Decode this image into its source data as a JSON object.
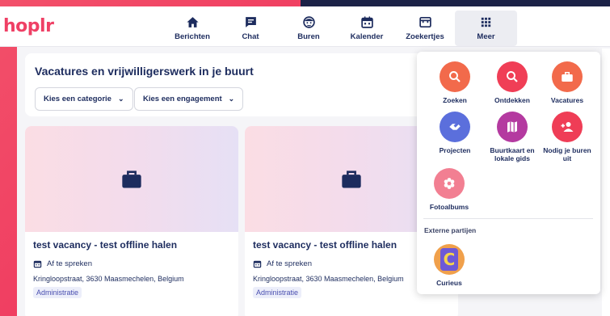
{
  "app": {
    "logo": "hoplr"
  },
  "nav": [
    {
      "label": "Berichten",
      "icon": "home-icon"
    },
    {
      "label": "Chat",
      "icon": "chat-icon"
    },
    {
      "label": "Buren",
      "icon": "neighbor-face-icon"
    },
    {
      "label": "Kalender",
      "icon": "calendar-icon"
    },
    {
      "label": "Zoekertjes",
      "icon": "shop-icon"
    },
    {
      "label": "Meer",
      "icon": "grid-icon",
      "active": true
    }
  ],
  "panel": {
    "title": "Vacatures en vrijwilligerswerk in je buurt",
    "filter_category": "Kies een categorie",
    "filter_engagement": "Kies een engagement"
  },
  "cards": [
    {
      "title": "test vacancy - test offline halen",
      "date": "Af te spreken",
      "address": "Kringloopstraat, 3630 Maasmechelen, Belgium",
      "tag": "Administratie"
    },
    {
      "title": "test vacancy - test offline halen",
      "date": "Af te spreken",
      "address": "Kringloopstraat, 3630 Maasmechelen, Belgium",
      "tag": "Administratie"
    }
  ],
  "menu": {
    "items": [
      {
        "label": "Zoeken",
        "icon": "search-icon",
        "color": "#f26a4b"
      },
      {
        "label": "Ontdekken",
        "icon": "search-icon",
        "color": "#f03e56"
      },
      {
        "label": "Vacatures",
        "icon": "briefcase-icon",
        "color": "#f26a4b"
      },
      {
        "label": "Projecten",
        "icon": "handshake-icon",
        "color": "#5b6fdc"
      },
      {
        "label": "Buurtkaart en lokale gids",
        "icon": "map-icon",
        "color": "#b43aa0"
      },
      {
        "label": "Nodig je buren uit",
        "icon": "add-user-icon",
        "color": "#ef3d56"
      },
      {
        "label": "Fotoalbums",
        "icon": "flower-icon",
        "color": "#f27f92"
      }
    ],
    "section_external": "Externe partijen",
    "external": [
      {
        "label": "Curieus",
        "icon": "curieus-logo",
        "logo_letter": "C"
      }
    ]
  },
  "colors": {
    "brand": "#ef4065",
    "navy": "#1d2c5e"
  }
}
